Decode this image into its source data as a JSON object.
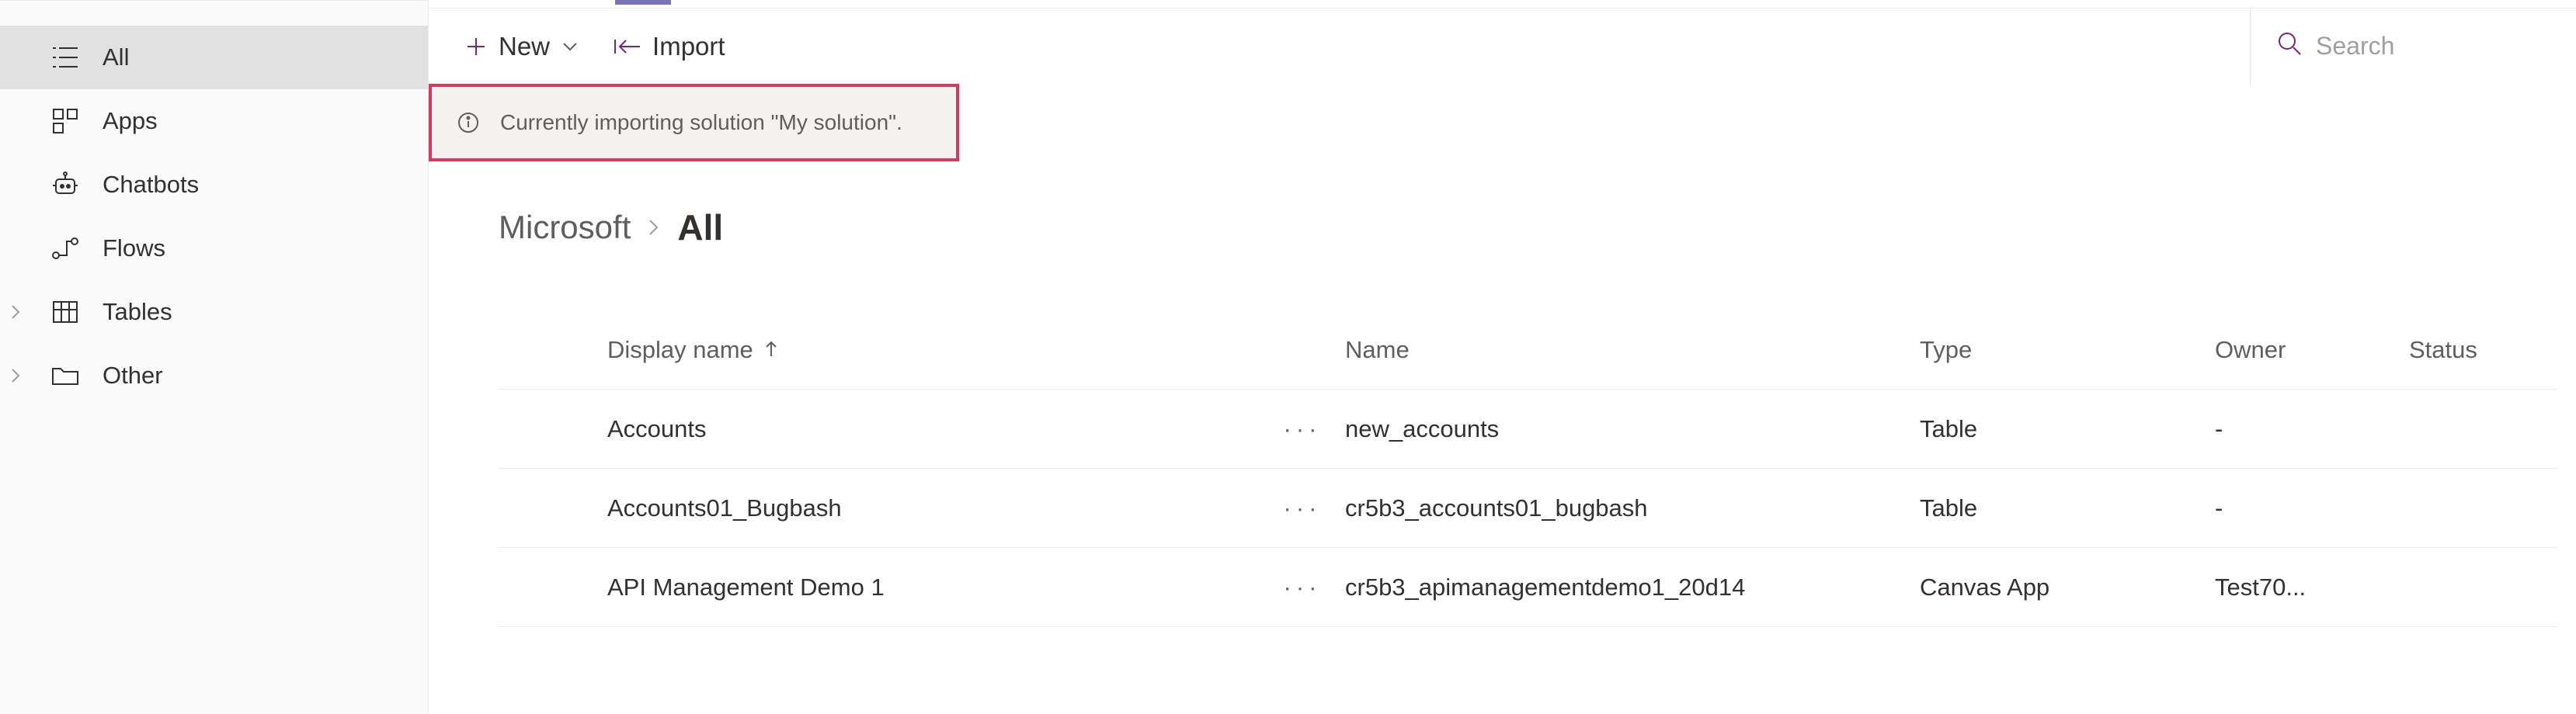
{
  "sidebar": {
    "items": [
      {
        "label": "All",
        "icon": "list-icon",
        "selected": true
      },
      {
        "label": "Apps",
        "icon": "app-grid-icon",
        "selected": false
      },
      {
        "label": "Chatbots",
        "icon": "bot-icon",
        "selected": false
      },
      {
        "label": "Flows",
        "icon": "flow-icon",
        "selected": false
      },
      {
        "label": "Tables",
        "icon": "table-icon",
        "selected": false,
        "expandable": true
      },
      {
        "label": "Other",
        "icon": "folder-icon",
        "selected": false,
        "expandable": true
      }
    ]
  },
  "commandBar": {
    "new_label": "New",
    "import_label": "Import"
  },
  "search": {
    "placeholder": "Search"
  },
  "banner": {
    "text": "Currently importing solution \"My solution\"."
  },
  "breadcrumb": {
    "root": "Microsoft",
    "current": "All"
  },
  "grid": {
    "headers": {
      "display_name": "Display name",
      "name": "Name",
      "type": "Type",
      "owner": "Owner",
      "status": "Status"
    },
    "rows": [
      {
        "display_name": "Accounts",
        "name": "new_accounts",
        "type": "Table",
        "owner": "-",
        "status": ""
      },
      {
        "display_name": "Accounts01_Bugbash",
        "name": "cr5b3_accounts01_bugbash",
        "type": "Table",
        "owner": "-",
        "status": ""
      },
      {
        "display_name": "API Management Demo 1",
        "name": "cr5b3_apimanagementdemo1_20d14",
        "type": "Canvas App",
        "owner": "Test70...",
        "status": ""
      }
    ],
    "row_actions_glyph": "···"
  }
}
